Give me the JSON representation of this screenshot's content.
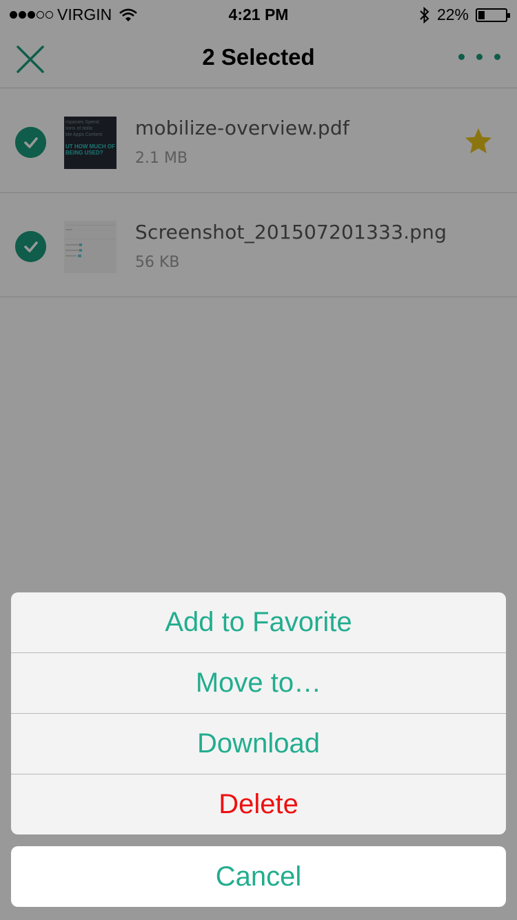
{
  "status_bar": {
    "carrier": "VIRGIN",
    "time": "4:21 PM",
    "battery_text": "22%",
    "battery_level": 0.22,
    "signal_bars_filled": 3,
    "signal_bars_total": 5
  },
  "nav": {
    "title": "2 Selected",
    "close_icon": "close-x-icon",
    "more_icon": "more-dots-icon"
  },
  "files": [
    {
      "name": "mobilize-overview.pdf",
      "size": "2.1 MB",
      "selected": true,
      "favorite": true,
      "thumb_lines": [
        "mpanies Spend",
        "lions of dolla",
        "ble Apps Content"
      ],
      "thumb_highlight": [
        "UT HOW MUCH OF",
        "BEING USED?"
      ]
    },
    {
      "name": "Screenshot_201507201333.png",
      "size": "56 KB",
      "selected": true,
      "favorite": false
    }
  ],
  "action_sheet": {
    "actions": [
      {
        "label": "Add to Favorite"
      },
      {
        "label": "Move to…"
      },
      {
        "label": "Download"
      },
      {
        "label": "Delete",
        "destructive": true
      }
    ],
    "cancel_label": "Cancel"
  },
  "colors": {
    "accent": "#1a9b7c",
    "action_text": "#22ad8f",
    "destructive": "#ee1010",
    "star": "#e8c41a"
  }
}
